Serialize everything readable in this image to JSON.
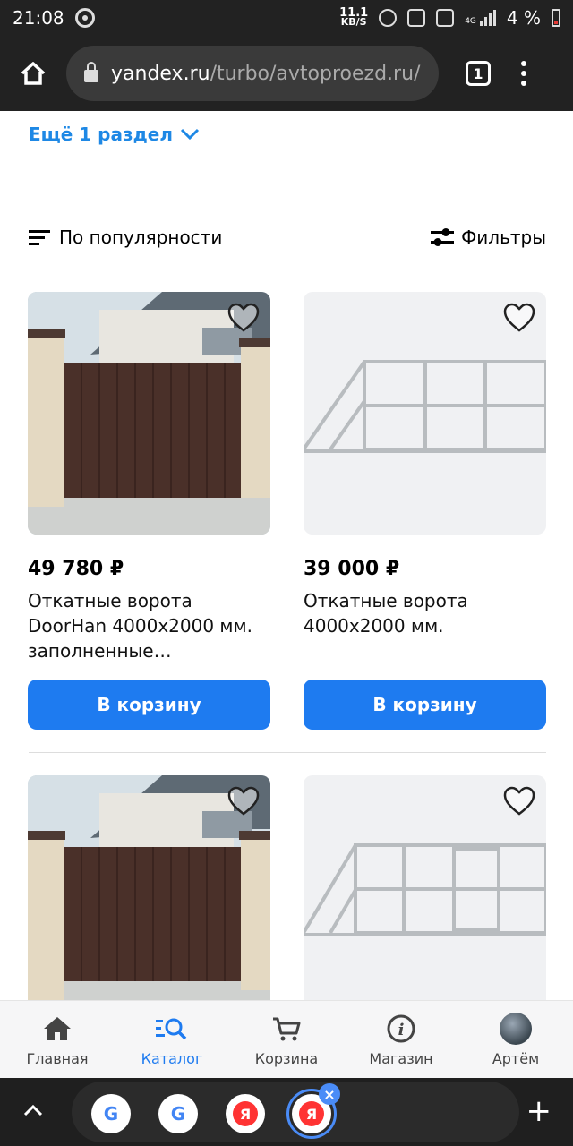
{
  "status_bar": {
    "time": "21:08",
    "net_speed": "11.1",
    "net_unit": "KB/S",
    "battery": "4 %",
    "network": "4G",
    "icons": [
      "sync-icon",
      "alarm-icon",
      "nfc-icon",
      "vibrate-icon",
      "signal-icon",
      "battery-icon"
    ]
  },
  "browser": {
    "url_host": "yandex.ru",
    "url_path": "/turbo/avtoproezd.ru/",
    "tab_count": "1"
  },
  "catalog": {
    "more_sections": "Ещё 1 раздел",
    "sort_label": "По популярности",
    "filters_label": "Фильтры"
  },
  "products": [
    {
      "price": "49 780 ₽",
      "title": "Откатные ворота DoorHan 4000x2000 мм. заполненные…",
      "button": "В корзину",
      "image": "brown-sliding-gate-photo"
    },
    {
      "price": "39 000 ₽",
      "title": "Откатные ворота 4000x2000 мм.",
      "button": "В корзину",
      "image": "gate-frame-drawing"
    },
    {
      "image": "brown-sliding-gate-photo"
    },
    {
      "image": "gate-frame-with-door-drawing"
    }
  ],
  "bottom_nav": {
    "items": [
      {
        "label": "Главная",
        "icon": "home-icon"
      },
      {
        "label": "Каталог",
        "icon": "catalog-search-icon",
        "active": true
      },
      {
        "label": "Корзина",
        "icon": "cart-icon"
      },
      {
        "label": "Магазин",
        "icon": "info-icon"
      },
      {
        "label": "Артём",
        "icon": "avatar"
      }
    ]
  },
  "tab_strip": {
    "tabs": [
      "G",
      "G",
      "Я",
      "Я"
    ]
  },
  "colors": {
    "accent": "#1e7bf0",
    "link": "#1e88e5",
    "dark_bar": "#222222"
  }
}
